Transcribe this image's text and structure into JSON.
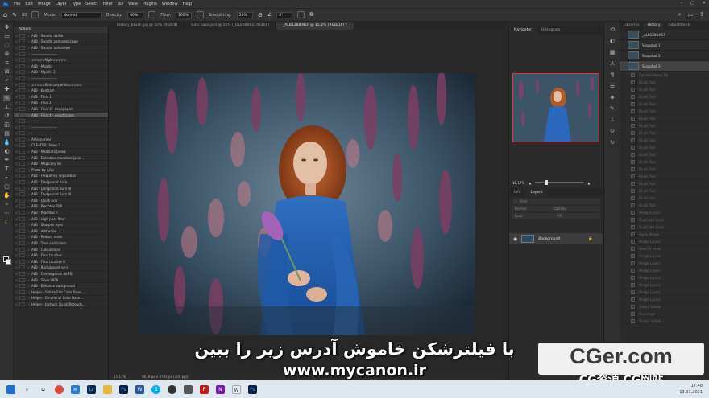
{
  "app": {
    "logo": "Ps",
    "menus": [
      "File",
      "Edit",
      "Image",
      "Layer",
      "Type",
      "Select",
      "Filter",
      "3D",
      "View",
      "Plugins",
      "Window",
      "Help"
    ],
    "window_controls": [
      "minimize-icon",
      "maximize-icon",
      "close-icon"
    ]
  },
  "options": {
    "mode_label": "Mode:",
    "mode_value": "Normal",
    "opacity_label": "Opacity:",
    "opacity_value": "60%",
    "flow_label": "Flow:",
    "flow_value": "100%",
    "smoothing_label": "Smoothing:",
    "smoothing_value": "20%",
    "angle_value": "0°",
    "brush_size": "80"
  },
  "tabs": [
    "history_brush.jpg @ 50% (RGB/8)",
    "tutki baza.psd @ 50% (_OLEX8902, RGB/8)",
    "_ALB1288.NEF @ 15,2% (RGB/16) *"
  ],
  "actions": {
    "title": "Actions",
    "rows": [
      {
        "label": "ALB - Światło dalšie",
        "sel": false
      },
      {
        "label": "ALB - Światło pomarańczowe",
        "sel": false
      },
      {
        "label": "ALB - Światło turkusowe",
        "sel": false
      },
      {
        "label": "----------------------",
        "sel": false
      },
      {
        "label": "=====Mgła=====",
        "sel": false
      },
      {
        "label": "ALB - Mgiełki",
        "sel": false
      },
      {
        "label": "ALB - Mgiełki 2",
        "sel": false
      },
      {
        "label": "----------------------",
        "sel": false
      },
      {
        "label": "=====Końcowy efekt=====",
        "sel": false
      },
      {
        "label": "ALB - Kontrast",
        "sel": false
      },
      {
        "label": "ALB - Final 1",
        "sel": false
      },
      {
        "label": "ALB - Final 2",
        "sel": false
      },
      {
        "label": "ALB - Final 3 - dodaj szum",
        "sel": false
      },
      {
        "label": "ALB - Final 4 - wyostrzanie",
        "sel": true
      },
      {
        "label": "----------------------",
        "sel": false
      },
      {
        "label": "----------------------",
        "sel": false
      },
      {
        "label": "----------------------",
        "sel": false
      },
      {
        "label": "Alfie surreal",
        "sel": false
      },
      {
        "label": "CREATED Filmer 2",
        "sel": false
      },
      {
        "label": "ALB - Madziara Jasiek",
        "sel": false
      },
      {
        "label": "ALB - Delikatna madziara jakie...",
        "sel": false
      },
      {
        "label": "ALB - Magiczny lek",
        "sel": false
      },
      {
        "label": "Photo by Alice",
        "sel": false
      },
      {
        "label": "ALB - Frequency Separation",
        "sel": false
      },
      {
        "label": "ALB - Dodge and Burn",
        "sel": false
      },
      {
        "label": "ALB - Dodge and Burn III",
        "sel": false
      },
      {
        "label": "ALB - Dodge and Burn III",
        "sel": false
      },
      {
        "label": "ALB - Quick skin",
        "sel": false
      },
      {
        "label": "ALB - Prachtos POP",
        "sel": false
      },
      {
        "label": "ALB - Prachtos II",
        "sel": false
      },
      {
        "label": "ALB - High pass filter",
        "sel": false
      },
      {
        "label": "ALB - Sharpen eyes",
        "sel": false
      },
      {
        "label": "ALB - Add noise",
        "sel": false
      },
      {
        "label": "ALB - Reduce noise",
        "sel": false
      },
      {
        "label": "ALB - Tone and colour",
        "sel": false
      },
      {
        "label": "ALB - Calculations",
        "sel": false
      },
      {
        "label": "ALB - Final touches",
        "sel": false
      },
      {
        "label": "ALB - Final touches II",
        "sel": false
      },
      {
        "label": "ALB - Background sync",
        "sel": false
      },
      {
        "label": "ALB - Convergence do FB",
        "sel": false
      },
      {
        "label": "ALB - Silver BEW",
        "sel": false
      },
      {
        "label": "ALB - Enhance background",
        "sel": false
      },
      {
        "label": "Helper - Subtle Edit Color Base ...",
        "sel": false
      },
      {
        "label": "Helper - Emotional Color Base ...",
        "sel": false
      },
      {
        "label": "Helper - Jochuck Quick Retouch...",
        "sel": false
      }
    ]
  },
  "status": {
    "zoom": "15,17%",
    "size": "6016 px x 4792 px (300 ppi)"
  },
  "navigator": {
    "tabs": [
      "Navigator",
      "Histogram"
    ],
    "zoom": "15,17%"
  },
  "layers": {
    "tabs": [
      "Info",
      "Layers"
    ],
    "kind_label": "Kind",
    "blend": "Normal",
    "opacity_label": "Opacity:",
    "lock_label": "Lock:",
    "fill_label": "Fill:",
    "layer_name": "Background"
  },
  "history": {
    "tabs": [
      "Libraries",
      "History",
      "Adjustments"
    ],
    "snapshots": [
      {
        "label": "_ALB1288.NEF",
        "sel": false
      },
      {
        "label": "Snapshot 1",
        "sel": false
      },
      {
        "label": "Snapshot 2",
        "sel": false
      },
      {
        "label": "Snapshot 3",
        "sel": true
      }
    ],
    "steps": [
      "Content-Aware Fill",
      "Brush Tool",
      "Brush Tool",
      "Brush Tool",
      "Brush Tool",
      "Brush Tool",
      "Brush Tool",
      "Brush Tool",
      "Brush Tool",
      "Brush Tool",
      "Brush Tool",
      "Brush Tool",
      "Brush Tool",
      "Brush Tool",
      "Brush Tool",
      "Brush Tool",
      "Brush Tool",
      "Brush Tool",
      "Brush Tool",
      "Merge Layers",
      "Duplicate Layer",
      "Duplicate Layer",
      "Apply Image",
      "Merge Layers",
      "New Fill Layer",
      "Merge Layers",
      "Merge Layers",
      "Merge Layers",
      "Merge Layers",
      "Merge Layers",
      "Merge Layers",
      "Merge Layers",
      "Stamp Visible",
      "New Layer",
      "Stamp Visible"
    ]
  },
  "subtitles": {
    "line1": "با فیلترشکن خاموش آدرس زیر را ببین",
    "line2": "www.mycanon.ir"
  },
  "watermark": {
    "main": "CGer.com",
    "sub": "CG资源  CG网站"
  },
  "taskbar": {
    "time": "17:48",
    "date": "13.01.2021"
  }
}
